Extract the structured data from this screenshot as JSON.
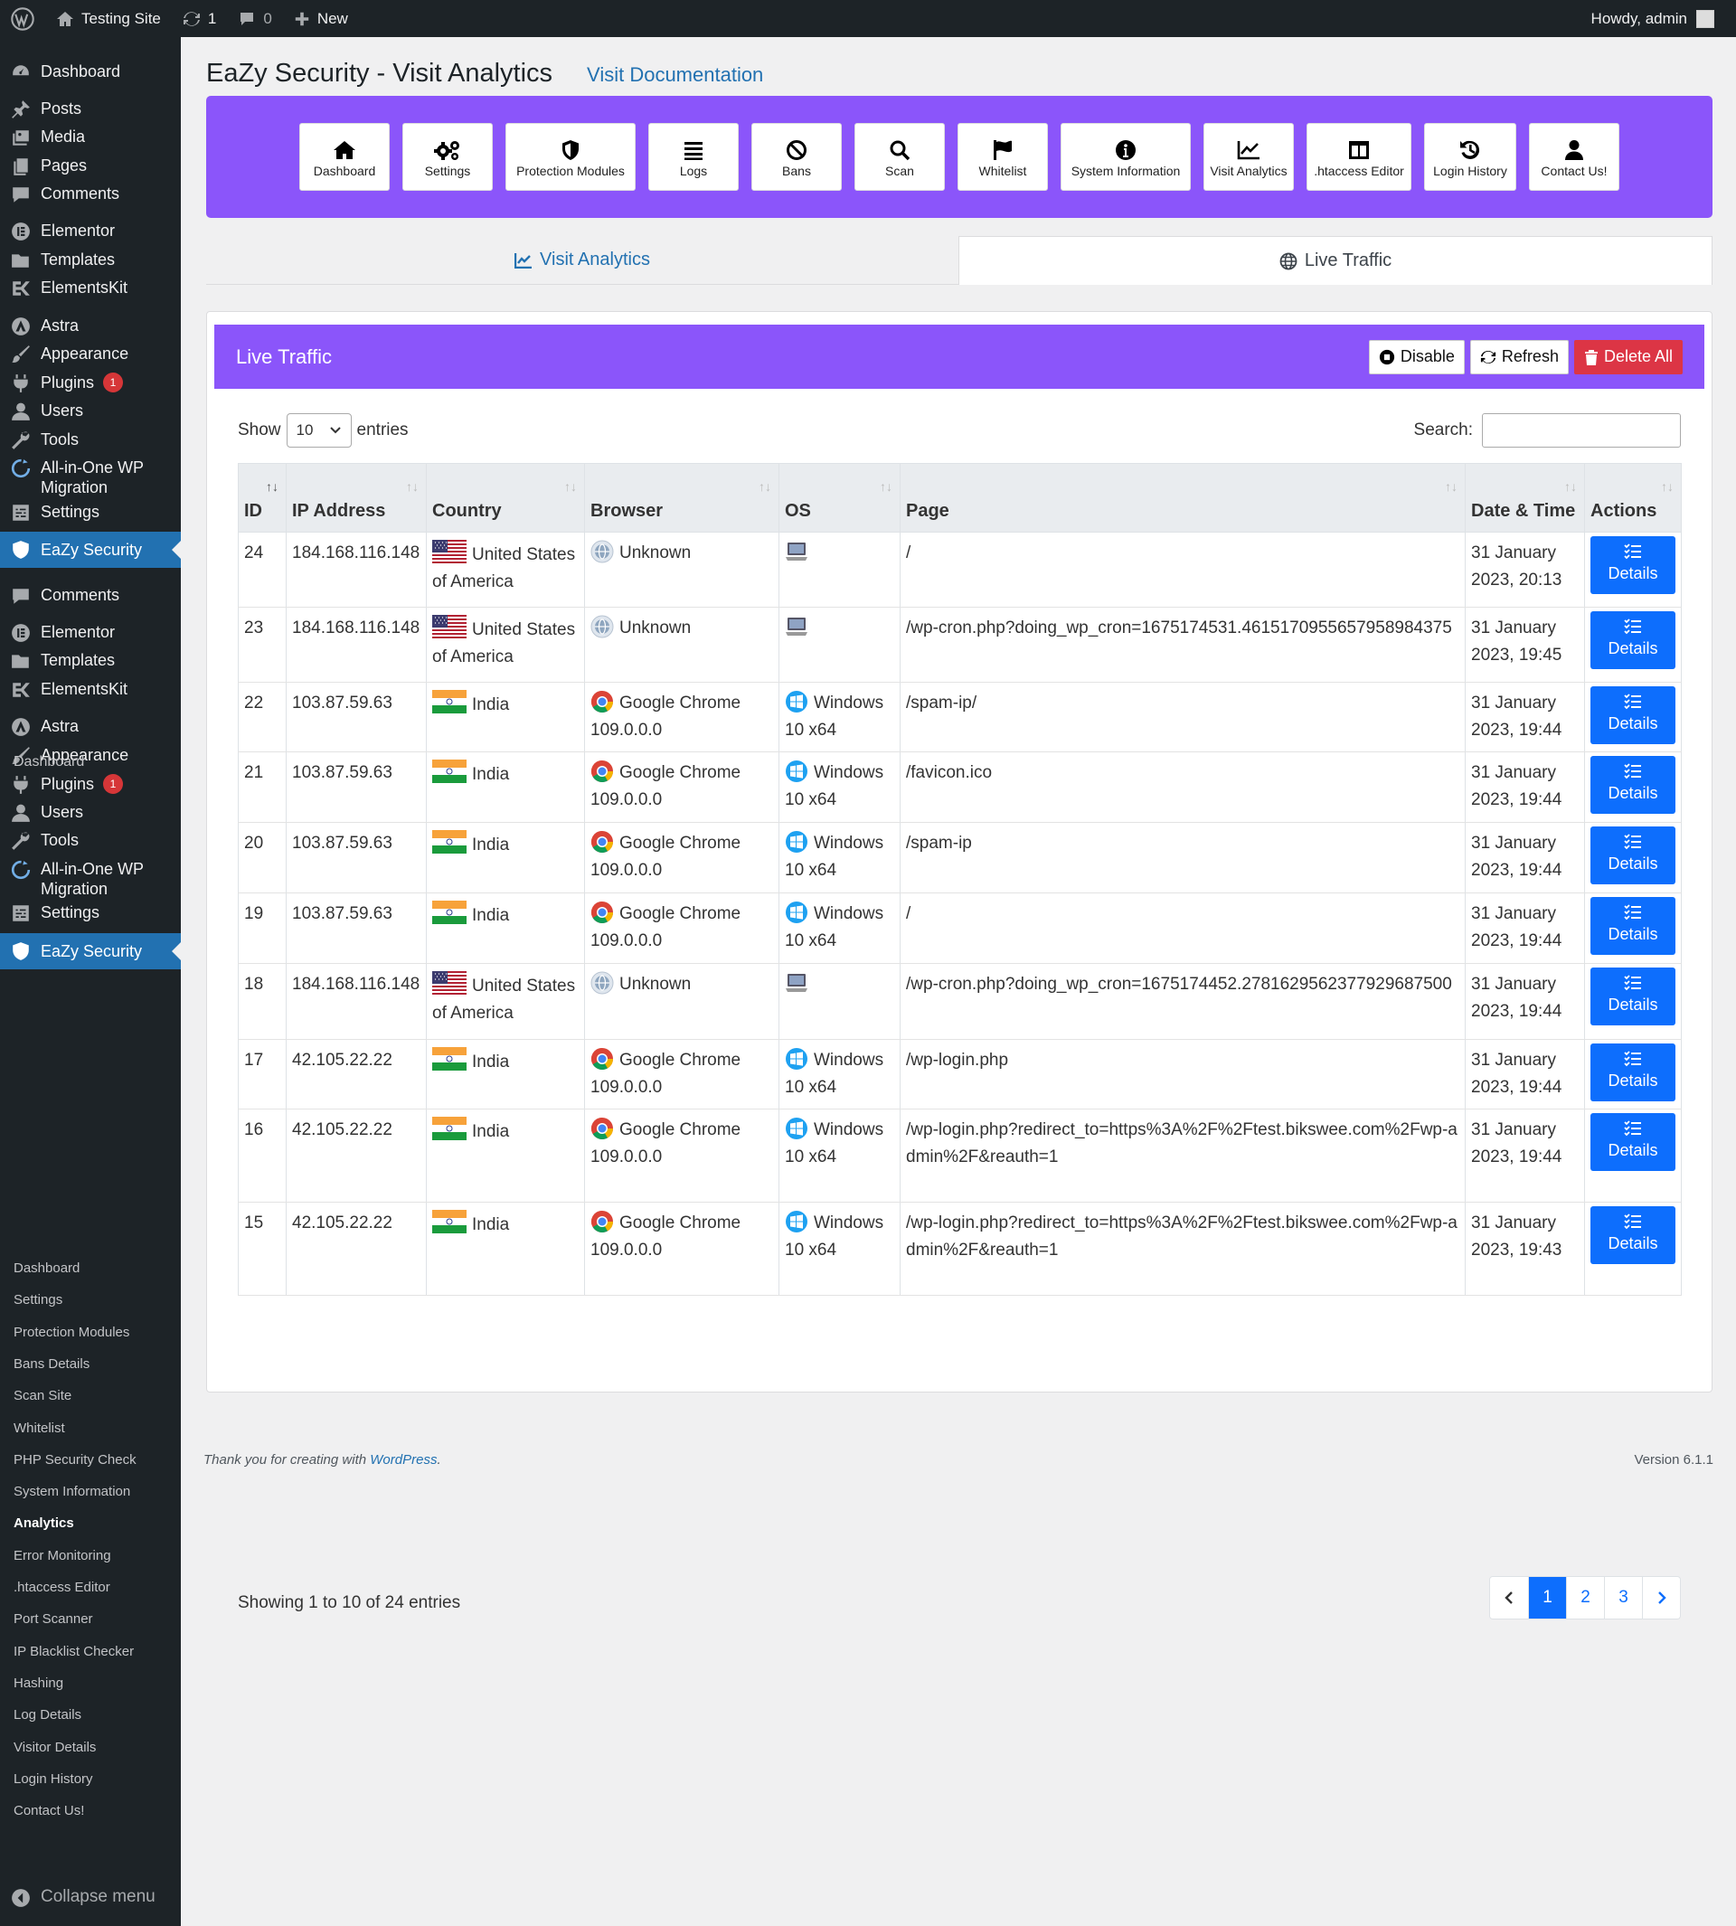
{
  "adminbar": {
    "site": "Testing Site",
    "updates": "1",
    "comments": "0",
    "new": "New",
    "howdy": "Howdy, admin"
  },
  "sidebar": {
    "items": [
      {
        "label": "Dashboard",
        "icon": "dashboard-icon",
        "badge": ""
      },
      {
        "label": "Posts",
        "icon": "pin-icon",
        "badge": ""
      },
      {
        "label": "Media",
        "icon": "media-icon",
        "badge": ""
      },
      {
        "label": "Pages",
        "icon": "pages-icon",
        "badge": ""
      },
      {
        "label": "Comments",
        "icon": "comment-icon",
        "badge": ""
      },
      {
        "label": "Elementor",
        "icon": "elementor-icon",
        "badge": ""
      },
      {
        "label": "Templates",
        "icon": "folder-icon",
        "badge": ""
      },
      {
        "label": "ElementsKit",
        "icon": "elementskit-icon",
        "badge": ""
      },
      {
        "label": "Astra",
        "icon": "astra-icon",
        "badge": ""
      },
      {
        "label": "Appearance",
        "icon": "brush-icon",
        "badge": ""
      },
      {
        "label": "Plugins",
        "icon": "plug-icon",
        "badge": "1"
      },
      {
        "label": "Users",
        "icon": "user-icon",
        "badge": ""
      },
      {
        "label": "Tools",
        "icon": "wrench-icon",
        "badge": ""
      },
      {
        "label": "All-in-One WP Migration",
        "icon": "migration-icon",
        "badge": ""
      },
      {
        "label": "Settings",
        "icon": "settings-icon",
        "badge": ""
      },
      {
        "label": "EaZy Security",
        "icon": "shield-icon",
        "badge": ""
      },
      {
        "label": "Comments",
        "icon": "comment-icon",
        "badge": ""
      },
      {
        "label": "Elementor",
        "icon": "elementor-icon",
        "badge": ""
      },
      {
        "label": "Templates",
        "icon": "folder-icon",
        "badge": ""
      },
      {
        "label": "ElementsKit",
        "icon": "elementskit-icon",
        "badge": ""
      },
      {
        "label": "Astra",
        "icon": "astra-icon",
        "badge": ""
      },
      {
        "label": "Appearance",
        "icon": "brush-icon",
        "badge": ""
      },
      {
        "label": "Plugins",
        "icon": "plug-icon",
        "badge": "1"
      },
      {
        "label": "Users",
        "icon": "user-icon",
        "badge": ""
      },
      {
        "label": "Tools",
        "icon": "wrench-icon",
        "badge": ""
      },
      {
        "label": "All-in-One WP Migration",
        "icon": "migration-icon",
        "badge": ""
      },
      {
        "label": "Settings",
        "icon": "settings-icon",
        "badge": ""
      },
      {
        "label": "EaZy Security",
        "icon": "shield-icon",
        "badge": ""
      }
    ],
    "overlap_label": "Dashboard",
    "submenu": [
      "Dashboard",
      "Settings",
      "Protection Modules",
      "Bans Details",
      "Scan Site",
      "Whitelist",
      "PHP Security Check",
      "System Information",
      "Analytics",
      "Error Monitoring",
      ".htaccess Editor",
      "Port Scanner",
      "IP Blacklist Checker",
      "Hashing",
      "Log Details",
      "Visitor Details",
      "Login History",
      "Contact Us!"
    ],
    "collapse": "Collapse menu"
  },
  "page": {
    "title": "EaZy Security - Visit Analytics",
    "doc_link": "Visit Documentation"
  },
  "toolbar": [
    {
      "label": "Dashboard",
      "icon": "home-icon"
    },
    {
      "label": "Settings",
      "icon": "gears-icon"
    },
    {
      "label": "Protection Modules",
      "icon": "shield-icon"
    },
    {
      "label": "Logs",
      "icon": "list-icon"
    },
    {
      "label": "Bans",
      "icon": "ban-icon"
    },
    {
      "label": "Scan",
      "icon": "search-icon"
    },
    {
      "label": "Whitelist",
      "icon": "flag-icon"
    },
    {
      "label": "System Information",
      "icon": "info-icon"
    },
    {
      "label": "Visit Analytics",
      "icon": "chart-icon"
    },
    {
      "label": ".htaccess Editor",
      "icon": "columns-icon"
    },
    {
      "label": "Login History",
      "icon": "history-icon"
    },
    {
      "label": "Contact Us!",
      "icon": "user-icon"
    }
  ],
  "tabs": {
    "visit_analytics": "Visit Analytics",
    "live_traffic": "Live Traffic"
  },
  "panel": {
    "title": "Live Traffic",
    "disable": "Disable",
    "refresh": "Refresh",
    "delete_all": "Delete All"
  },
  "table": {
    "show": "Show",
    "length": "10",
    "entries": "entries",
    "search_label": "Search:",
    "columns": [
      "ID",
      "IP Address",
      "Country",
      "Browser",
      "OS",
      "Page",
      "Date & Time",
      "Actions"
    ],
    "details_label": "Details",
    "rows": [
      {
        "id": "24",
        "ip": "184.168.116.148",
        "country": "United States of America",
        "flag": "us",
        "browser": "Unknown",
        "bicon": "unknown",
        "os": "",
        "osicon": "pc",
        "page": "/",
        "date": "31 January 2023, 20:13"
      },
      {
        "id": "23",
        "ip": "184.168.116.148",
        "country": "United States of America",
        "flag": "us",
        "browser": "Unknown",
        "bicon": "unknown",
        "os": "",
        "osicon": "pc",
        "page": "/wp-cron.php?doing_wp_cron=1675174531.4615170955657958984375",
        "date": "31 January 2023, 19:45"
      },
      {
        "id": "22",
        "ip": "103.87.59.63",
        "country": "India",
        "flag": "in",
        "browser": "Google Chrome 109.0.0.0",
        "bicon": "chrome",
        "os": "Windows 10 x64",
        "osicon": "windows",
        "page": "/spam-ip/",
        "date": "31 January 2023, 19:44"
      },
      {
        "id": "21",
        "ip": "103.87.59.63",
        "country": "India",
        "flag": "in",
        "browser": "Google Chrome 109.0.0.0",
        "bicon": "chrome",
        "os": "Windows 10 x64",
        "osicon": "windows",
        "page": "/favicon.ico",
        "date": "31 January 2023, 19:44"
      },
      {
        "id": "20",
        "ip": "103.87.59.63",
        "country": "India",
        "flag": "in",
        "browser": "Google Chrome 109.0.0.0",
        "bicon": "chrome",
        "os": "Windows 10 x64",
        "osicon": "windows",
        "page": "/spam-ip",
        "date": "31 January 2023, 19:44"
      },
      {
        "id": "19",
        "ip": "103.87.59.63",
        "country": "India",
        "flag": "in",
        "browser": "Google Chrome 109.0.0.0",
        "bicon": "chrome",
        "os": "Windows 10 x64",
        "osicon": "windows",
        "page": "/",
        "date": "31 January 2023, 19:44"
      },
      {
        "id": "18",
        "ip": "184.168.116.148",
        "country": "United States of America",
        "flag": "us",
        "browser": "Unknown",
        "bicon": "unknown",
        "os": "",
        "osicon": "pc",
        "page": "/wp-cron.php?doing_wp_cron=1675174452.2781629562377929687500",
        "date": "31 January 2023, 19:44"
      },
      {
        "id": "17",
        "ip": "42.105.22.22",
        "country": "India",
        "flag": "in",
        "browser": "Google Chrome 109.0.0.0",
        "bicon": "chrome",
        "os": "Windows 10 x64",
        "osicon": "windows",
        "page": "/wp-login.php",
        "date": "31 January 2023, 19:44"
      },
      {
        "id": "16",
        "ip": "42.105.22.22",
        "country": "India",
        "flag": "in",
        "browser": "Google Chrome 109.0.0.0",
        "bicon": "chrome",
        "os": "Windows 10 x64",
        "osicon": "windows",
        "page": "/wp-login.php?redirect_to=https%3A%2F%2Ftest.bikswee.com%2Fwp-admin%2F&reauth=1",
        "date": "31 January 2023, 19:44"
      },
      {
        "id": "15",
        "ip": "42.105.22.22",
        "country": "India",
        "flag": "in",
        "browser": "Google Chrome 109.0.0.0",
        "bicon": "chrome",
        "os": "Windows 10 x64",
        "osicon": "windows",
        "page": "/wp-login.php?redirect_to=https%3A%2F%2Ftest.bikswee.com%2Fwp-admin%2F&reauth=1",
        "date": "31 January 2023, 19:43"
      }
    ],
    "info": "Showing 1 to 10 of 24 entries",
    "pages": [
      "1",
      "2",
      "3"
    ]
  },
  "footer": {
    "thanks": "Thank you for creating with ",
    "wp": "WordPress",
    "period": ".",
    "version": "Version 6.1.1"
  },
  "colors": {
    "accent": "#8b55fa",
    "wp_blue": "#2271b1",
    "button_blue": "#0d6efd",
    "danger": "#dc3545",
    "admin_dark": "#1d2327"
  }
}
